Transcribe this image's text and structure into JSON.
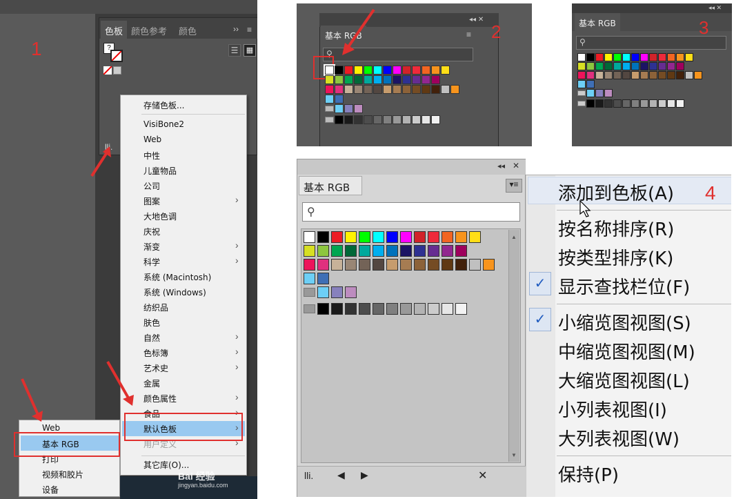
{
  "panel1": {
    "step": "1",
    "tabs": [
      "色板",
      "颜色参考",
      "颜色"
    ],
    "tab_more": "››",
    "menu": {
      "save": "存储色板...",
      "items": [
        {
          "label": "VisiBone2",
          "sub": false
        },
        {
          "label": "Web",
          "sub": false
        },
        {
          "label": "中性",
          "sub": false
        },
        {
          "label": "儿童物品",
          "sub": false
        },
        {
          "label": "公司",
          "sub": false
        },
        {
          "label": "图案",
          "sub": true
        },
        {
          "label": "大地色调",
          "sub": false
        },
        {
          "label": "庆祝",
          "sub": false
        },
        {
          "label": "渐变",
          "sub": true
        },
        {
          "label": "科学",
          "sub": true
        },
        {
          "label": "系统 (Macintosh)",
          "sub": false
        },
        {
          "label": "系统 (Windows)",
          "sub": false
        },
        {
          "label": "纺织品",
          "sub": false
        },
        {
          "label": "肤色",
          "sub": false
        },
        {
          "label": "自然",
          "sub": true
        },
        {
          "label": "色标簿",
          "sub": true
        },
        {
          "label": "艺术史",
          "sub": true
        },
        {
          "label": "金属",
          "sub": false
        },
        {
          "label": "颜色属性",
          "sub": true
        },
        {
          "label": "食品",
          "sub": true
        },
        {
          "label": "默认色板",
          "sub": true,
          "selected": true
        },
        {
          "label": "用户定义",
          "sub": true
        }
      ],
      "other": "其它库(O)..."
    },
    "submenu": [
      "Web",
      "基本 RGB",
      "打印",
      "视频和胶片",
      "设备"
    ],
    "submenu_selected": "基本 RGB",
    "watermark": "Bai 经验",
    "watermark_sub": "jingyan.baidu.com"
  },
  "panel2": {
    "step": "2",
    "tab": "基本 RGB"
  },
  "panel3": {
    "step": "3",
    "tab": "基本 RGB"
  },
  "panel4": {
    "step": "4",
    "tab": "基本 RGB",
    "menu": [
      {
        "label": "添加到色板(A)",
        "checked": false,
        "highlight": true
      },
      {
        "label": "按名称排序(R)",
        "checked": false,
        "sep_before": true
      },
      {
        "label": "按类型排序(K)",
        "checked": false
      },
      {
        "label": "显示查找栏位(F)",
        "checked": true
      },
      {
        "label": "小缩览图视图(S)",
        "checked": true,
        "sep_before": true
      },
      {
        "label": "中缩览图视图(M)",
        "checked": false
      },
      {
        "label": "大缩览图视图(L)",
        "checked": false
      },
      {
        "label": "小列表视图(I)",
        "checked": false
      },
      {
        "label": "大列表视图(W)",
        "checked": false
      },
      {
        "label": "保持(P)",
        "checked": false,
        "sep_before": true
      }
    ]
  },
  "swatches": {
    "row1": [
      "#ffffff",
      "#000000",
      "#ed1c24",
      "#fff200",
      "#00ff00",
      "#00ffff",
      "#0000ff",
      "#ff00ff",
      "#d2232a",
      "#ee2a3b",
      "#f26522",
      "#f7941d",
      "#ffde17"
    ],
    "row2": [
      "#d7df23",
      "#8dc63f",
      "#00a651",
      "#006838",
      "#00a99d",
      "#00aeef",
      "#0072bc",
      "#1b1464",
      "#2e3192",
      "#662d91",
      "#92278f",
      "#9e005d"
    ],
    "row3": [
      "#ed145b",
      "#e0317e",
      "#c7b299",
      "#998675",
      "#736357",
      "#534741",
      "#c69c6d",
      "#a67c52",
      "#8c6239",
      "#754c24",
      "#603913",
      "#42210b",
      "#c0c0c0",
      "#f7941d"
    ],
    "row4": [
      "#6dcff6",
      "#3f6fb5"
    ],
    "group1": [
      "#6dcff6",
      "#8781bd",
      "#bd8cbf"
    ],
    "group2": [
      "#000000",
      "#1a1a1a",
      "#333333",
      "#4d4d4d",
      "#666666",
      "#808080",
      "#999999",
      "#b3b3b3",
      "#cccccc",
      "#e6e6e6",
      "#f2f2f2"
    ]
  }
}
